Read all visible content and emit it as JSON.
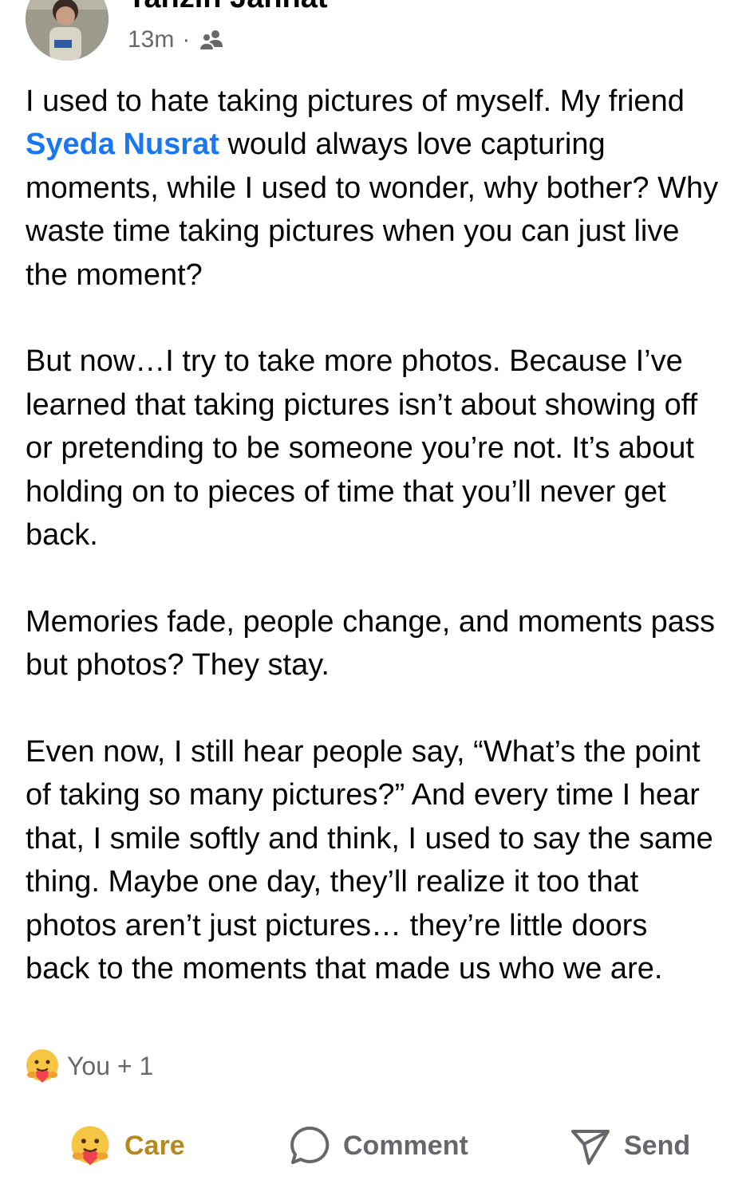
{
  "post": {
    "author_name": "Tanzin Jannat",
    "time": "13m",
    "separator": "·",
    "audience_icon": "friends-icon",
    "paragraphs": [
      {
        "before_mention": "I used to hate taking pictures of myself. My friend ",
        "mention": "Syeda Nusrat",
        "after_mention": " would always love capturing moments, while I used to wonder, why bother? Why waste time taking pictures when you can just live the moment?"
      },
      {
        "text": "But now…I try to take more photos. Because I’ve learned that taking pictures isn’t about showing off or pretending to be someone you’re not. It’s about holding on to pieces of time that you’ll never get back."
      },
      {
        "text": "Memories fade, people change, and moments pass but photos? They stay."
      },
      {
        "text": "Even now, I still hear people say, “What’s the point of taking so many pictures?” And every time I hear that, I smile softly and think, I used to say the same thing. Maybe one day, they’ll realize it too  that photos aren’t just pictures… they’re little doors back to the moments that made us who we are."
      }
    ]
  },
  "reactions": {
    "icon": "care-emoji-icon",
    "summary": "You + 1"
  },
  "actions": {
    "care_label": "Care",
    "comment_label": "Comment",
    "send_label": "Send"
  },
  "colors": {
    "mention": "#1877f2",
    "care_active": "#b48a1e",
    "secondary_text": "#65676b"
  }
}
